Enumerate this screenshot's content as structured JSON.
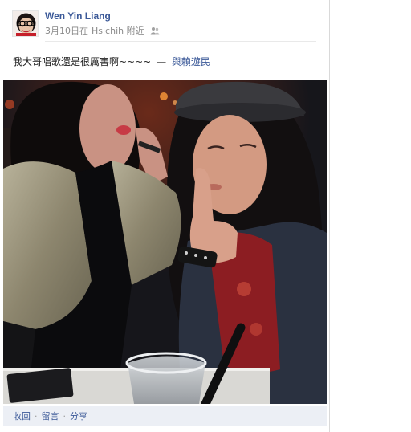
{
  "post": {
    "author": "Wen Yin Liang",
    "date": "3月10日在",
    "place": "Hsichih 附近",
    "status_text": "我大哥唱歌還是很厲害啊~~~~",
    "dash": "—",
    "with_label": "與賴遊民"
  },
  "actions": {
    "collapse": "收回",
    "comment": "留言",
    "share": "分享",
    "separator": "·"
  },
  "colors": {
    "link": "#3b5998",
    "meta": "#8a8a8a",
    "action_bar": "#eceff5"
  }
}
